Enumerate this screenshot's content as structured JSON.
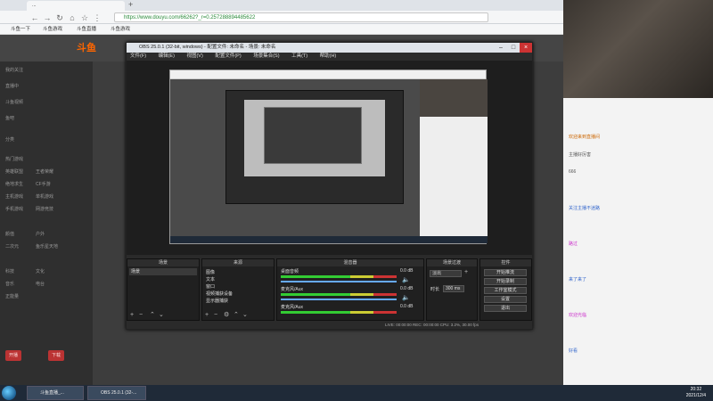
{
  "browser": {
    "tab_title": "...",
    "url": "https://www.douyu.com/66262?_r=0.257288894485622",
    "bookmarks": [
      "斗鱼一下",
      "斗鱼游戏",
      "斗鱼直播",
      "斗鱼游戏"
    ]
  },
  "site": {
    "logo_text": "斗鱼",
    "sidebar_rows": [
      "我的关注",
      "直播中",
      "斗鱼视频",
      "鱼吧",
      "分类",
      "热门游戏",
      "英雄联盟",
      "王者荣耀",
      "绝地求生",
      "CF手游",
      "主机游戏",
      "单机游戏",
      "手机游戏",
      "网游竞技",
      "颜值",
      "户外",
      "二次元",
      "鱼乐星天地",
      "科技",
      "文化",
      "音乐",
      "电台",
      "正能量"
    ],
    "sidebar_buttons": [
      "开播",
      "下载"
    ]
  },
  "obs": {
    "title": "OBS 25.0.1 (32-bit, windows) - 配置文件: 未命名 - 场景: 未命名",
    "menu": [
      "文件(F)",
      "编辑(E)",
      "视图(V)",
      "配置文件(P)",
      "场景集合(S)",
      "工具(T)",
      "帮助(H)"
    ],
    "docks": {
      "scenes": {
        "header": "场景",
        "items": [
          "场景"
        ]
      },
      "sources": {
        "header": "来源",
        "items": [
          "图像",
          "文本",
          "窗口",
          "视频捕获设备",
          "显示器捕获"
        ]
      },
      "mixer": {
        "header": "混音器",
        "channels": [
          {
            "name": "桌面音频",
            "db": "0.0 dB"
          },
          {
            "name": "麦克风/Aux",
            "db": "0.0 dB"
          },
          {
            "name": "麦克风/Aux",
            "db": "0.0 dB"
          }
        ]
      },
      "transitions": {
        "header": "场景过渡",
        "type": "淡出",
        "duration_label": "时长",
        "duration": "300 ms"
      },
      "controls": {
        "header": "控件",
        "buttons": [
          "开始推流",
          "开始录制",
          "工作室模式",
          "设置",
          "退出"
        ]
      }
    },
    "status": "LIVE: 00:00:00   REC: 00:00:00   CPU: 3.2%, 30.00 fps"
  },
  "chat": {
    "lines": [
      "欢迎来到直播间",
      "主播好厉害",
      "666",
      "关注主播不迷路",
      "路过",
      "来了来了",
      "欢迎光临",
      "好看"
    ]
  },
  "taskbar": {
    "items": [
      "斗鱼直播_...",
      "OBS 25.0.1 (32-..."
    ],
    "time": "20:32",
    "date": "2021/12/4"
  }
}
